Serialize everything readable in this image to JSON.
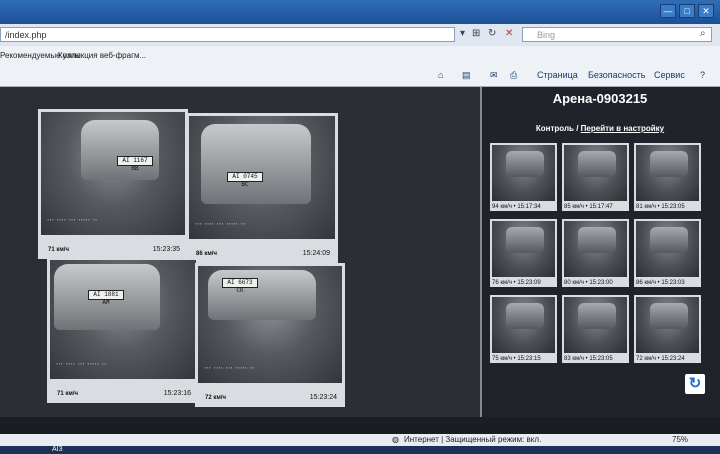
{
  "window": {
    "title": "",
    "buttons": [
      "—",
      "□",
      "✕"
    ]
  },
  "browser": {
    "address": "/index.php",
    "search_placeholder": "Bing",
    "favorites": [
      "Рекомендуемые узлы",
      "Коллекция веб-фрагм..."
    ],
    "commands": [
      "Страница",
      "Безопасность",
      "Сервис"
    ],
    "status_text": "Интернет | Защищенный режим: вкл.",
    "zoom": "75%"
  },
  "right_panel": {
    "title": "Арена-0903215",
    "control_label": "Контроль",
    "separator": "/",
    "settings_link": "Перейти в настройку"
  },
  "main_shots": [
    {
      "plate": "АІ 1167 ВВ",
      "speed": "71 км/ч",
      "time": "15:23:35"
    },
    {
      "plate": "АІ 0745 ВС",
      "speed": "86 км/ч",
      "time": "15:24:09"
    },
    {
      "plate": "АІ 1881 АМ",
      "speed": "71 км/ч",
      "time": "15:23:16"
    },
    {
      "plate": "АІ 6673 СК",
      "speed": "72 км/ч",
      "time": "15:23:24"
    }
  ],
  "thumbs": [
    {
      "caption": "94 км/ч • 15:17:34"
    },
    {
      "caption": "85 км/ч • 15:17:47"
    },
    {
      "caption": "81 км/ч • 15:23:05"
    },
    {
      "caption": "76 км/ч • 15:23:09"
    },
    {
      "caption": "80 км/ч • 15:23:00"
    },
    {
      "caption": "86 км/ч • 15:23:03"
    },
    {
      "caption": "75 км/ч • 15:23:15"
    },
    {
      "caption": "83 км/ч • 15:23:05"
    },
    {
      "caption": "72 км/ч • 15:23:24"
    }
  ],
  "taskbar": {
    "app_label": "AI3"
  }
}
